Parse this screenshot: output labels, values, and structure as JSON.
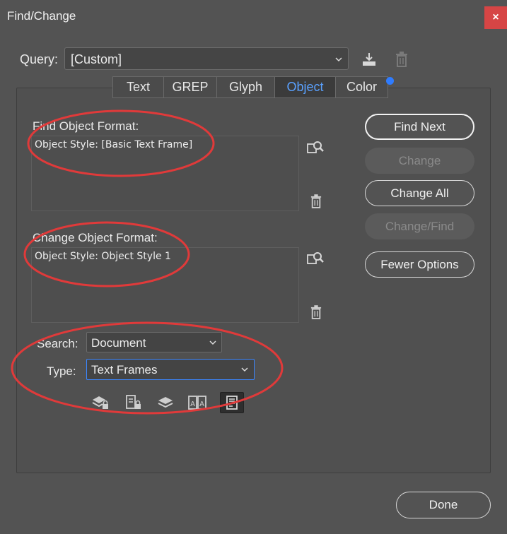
{
  "window": {
    "title": "Find/Change",
    "close_glyph": "×"
  },
  "query": {
    "label": "Query:",
    "value": "[Custom]"
  },
  "tabs": [
    {
      "label": "Text",
      "active": false
    },
    {
      "label": "GREP",
      "active": false
    },
    {
      "label": "Glyph",
      "active": false
    },
    {
      "label": "Object",
      "active": true
    },
    {
      "label": "Color",
      "active": false
    }
  ],
  "find_format": {
    "label": "Find Object Format:",
    "value": "Object Style: [Basic Text Frame]"
  },
  "change_format": {
    "label": "Change Object Format:",
    "value": "Object Style: Object Style 1"
  },
  "buttons": {
    "find_next": "Find Next",
    "change": "Change",
    "change_all": "Change All",
    "change_find": "Change/Find",
    "fewer_options": "Fewer Options",
    "done": "Done"
  },
  "search": {
    "label": "Search:",
    "value": "Document"
  },
  "type": {
    "label": "Type:",
    "value": "Text Frames"
  },
  "option_icons": [
    "locked-layers-icon",
    "locked-items-icon",
    "hidden-layers-icon",
    "master-pages-icon",
    "footnotes-icon"
  ],
  "colors": {
    "accent": "#5aa1ff",
    "annotation": "#e03a3a",
    "close": "#d64545"
  }
}
